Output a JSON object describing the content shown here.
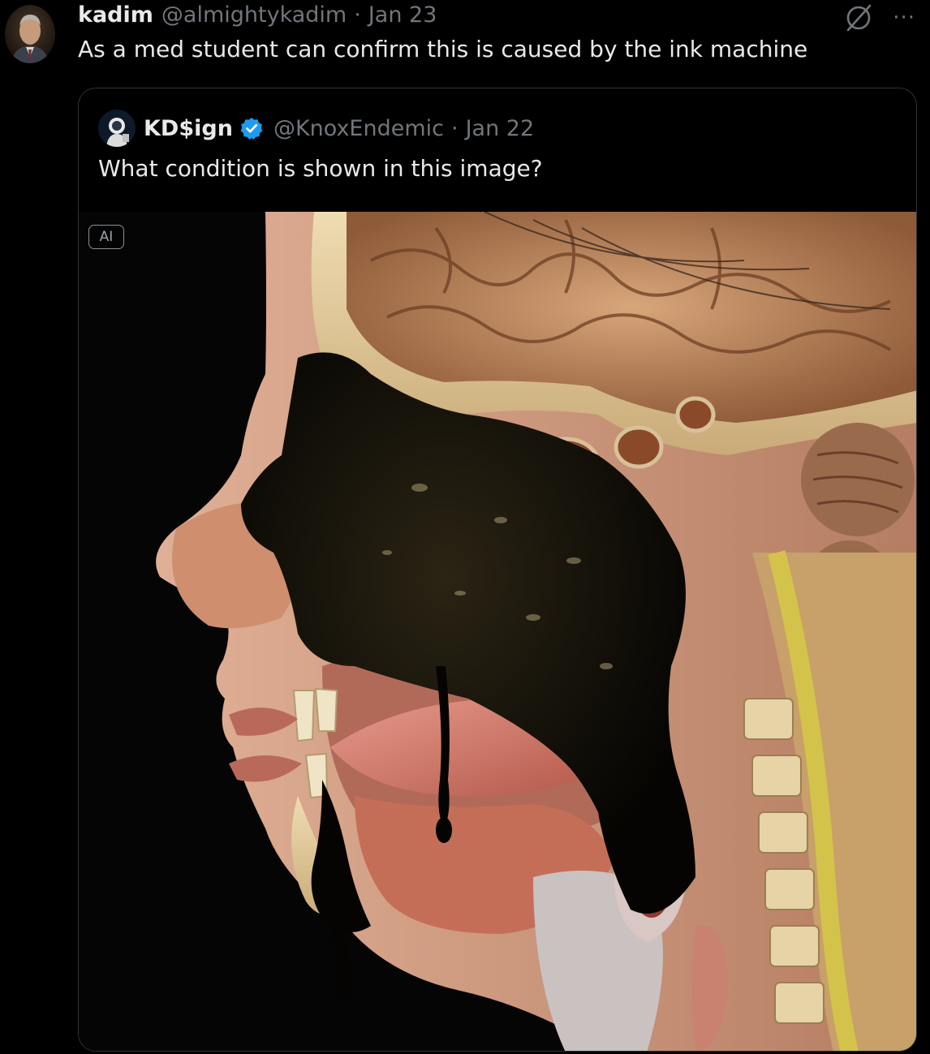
{
  "tweet": {
    "author_name": "kadim",
    "author_handle": "@almightykadim",
    "separator": "·",
    "date": "Jan 23",
    "text": "As a med student can confirm this is caused by the ink machine",
    "actions": {
      "grok_icon": "grok-icon",
      "more_label": "···"
    }
  },
  "quoted_tweet": {
    "author_name": "KD$ign",
    "verified": true,
    "author_handle": "@KnoxEndemic",
    "separator": "·",
    "date": "Jan 22",
    "text": "What condition is shown in this image?",
    "media": {
      "badge": "AI",
      "description_icon": "anatomical-head-cross-section-image"
    }
  },
  "colors": {
    "background": "#000000",
    "text_primary": "#e7e9ea",
    "text_secondary": "#71767b",
    "border": "#2f3336",
    "verified_blue": "#1d9bf0"
  }
}
